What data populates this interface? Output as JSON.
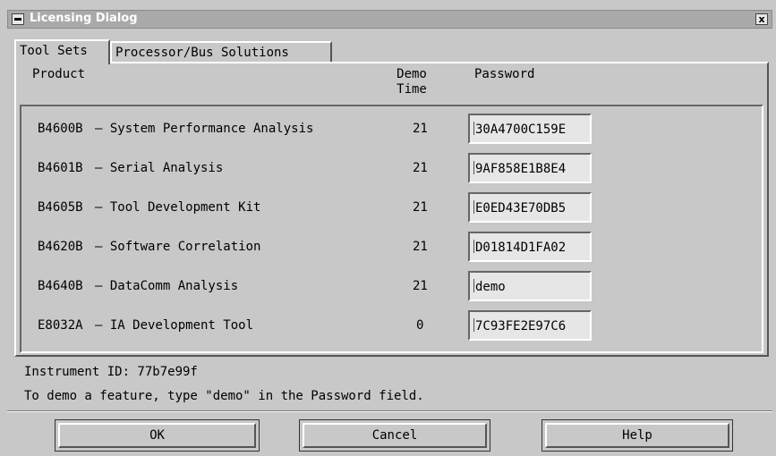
{
  "window": {
    "title": "Licensing Dialog",
    "close_glyph": "x"
  },
  "tabs": [
    {
      "label": "Tool Sets",
      "active": true
    },
    {
      "label": "Processor/Bus Solutions",
      "active": false
    }
  ],
  "columns": {
    "product": "Product",
    "demo_time_1": "Demo",
    "demo_time_2": "Time",
    "password": "Password"
  },
  "products": [
    {
      "code": "B4600B",
      "name": "– System Performance Analysis",
      "demo_time": "21",
      "password": "30A4700C159E"
    },
    {
      "code": "B4601B",
      "name": "– Serial Analysis",
      "demo_time": "21",
      "password": "9AF858E1B8E4"
    },
    {
      "code": "B4605B",
      "name": "– Tool Development Kit",
      "demo_time": "21",
      "password": "E0ED43E70DB5"
    },
    {
      "code": "B4620B",
      "name": "– Software Correlation",
      "demo_time": "21",
      "password": "D01814D1FA02"
    },
    {
      "code": "B4640B",
      "name": "– DataComm Analysis",
      "demo_time": "21",
      "password": "demo"
    },
    {
      "code": "E8032A",
      "name": "– IA Development Tool",
      "demo_time": "0",
      "password": "7C93FE2E97C6"
    }
  ],
  "info": {
    "instrument_id": "Instrument ID: 77b7e99f",
    "hint": "To demo a feature, type \"demo\" in the Password field."
  },
  "buttons": {
    "ok": "OK",
    "cancel": "Cancel",
    "help": "Help"
  }
}
